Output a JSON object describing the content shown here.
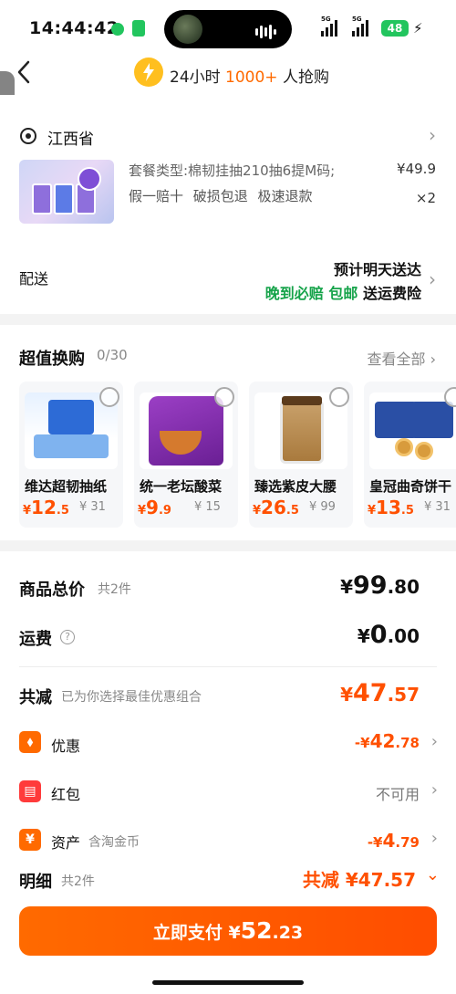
{
  "status_bar": {
    "time": "14:44:42",
    "signal_a": "5G",
    "signal_b": "5G",
    "battery": "48",
    "icons": [
      "wechat-icon",
      "app-icon",
      "charging-bolt-icon"
    ]
  },
  "header": {
    "hero_prefix": "24小时",
    "hero_highlight": "1000+",
    "hero_suffix": "人抢购",
    "icons": [
      "back-arrow-icon",
      "lightning-badge-icon"
    ]
  },
  "order": {
    "address": "江西省",
    "product_spec": "套餐类型:棉韧挂抽210抽6提M码;",
    "product_price": "¥49.9",
    "product_tags": "假一赔十 破损包退 极速退款",
    "product_qty": "×2",
    "delivery_label": "配送",
    "delivery_main": "预计明天送达",
    "delivery_badge_1": "晚到必赔",
    "delivery_badge_2": "包邮",
    "delivery_badge_3": "送运费险"
  },
  "swap": {
    "title": "超值换购",
    "count": "0/30",
    "view_all": "查看全部",
    "items": [
      {
        "name": "维达超韧抽纸",
        "price_int": "12",
        "price_dec": ".5",
        "orig": "¥ 31",
        "image": "tissue-image"
      },
      {
        "name": "统一老坛酸菜",
        "price_int": "9",
        "price_dec": ".9",
        "orig": "¥ 15",
        "image": "noodle-image"
      },
      {
        "name": "臻选紫皮大腰",
        "price_int": "26",
        "price_dec": ".5",
        "orig": "¥ 99",
        "image": "cashew-image"
      },
      {
        "name": "皇冠曲奇饼干",
        "price_int": "13",
        "price_dec": ".5",
        "orig": "¥ 31",
        "image": "cookie-image"
      }
    ]
  },
  "summary": {
    "total_label": "商品总价",
    "total_sub": "共2件",
    "total_int": "99",
    "total_dec": ".80",
    "shipping_label": "运费",
    "shipping_int": "0",
    "shipping_dec": ".00",
    "discount_label": "共减",
    "discount_sub": "已为你选择最佳优惠组合",
    "discount_int": "47",
    "discount_dec": ".57",
    "coupon_label": "优惠",
    "coupon_int": "42",
    "coupon_dec": ".78",
    "redpack_label": "红包",
    "redpack_val": "不可用",
    "asset_label": "资产",
    "asset_sub": "含淘金币",
    "asset_int": "4",
    "asset_dec": ".79",
    "detail_label": "明细",
    "detail_sub": "共2件",
    "detail_val": "共减 ¥47.57"
  },
  "pay": {
    "label": "立即支付 ¥",
    "int": "52",
    "dec": ".23"
  },
  "colors": {
    "accent": "#ff5000",
    "green": "#16a34a",
    "button": "#ff6a00"
  }
}
